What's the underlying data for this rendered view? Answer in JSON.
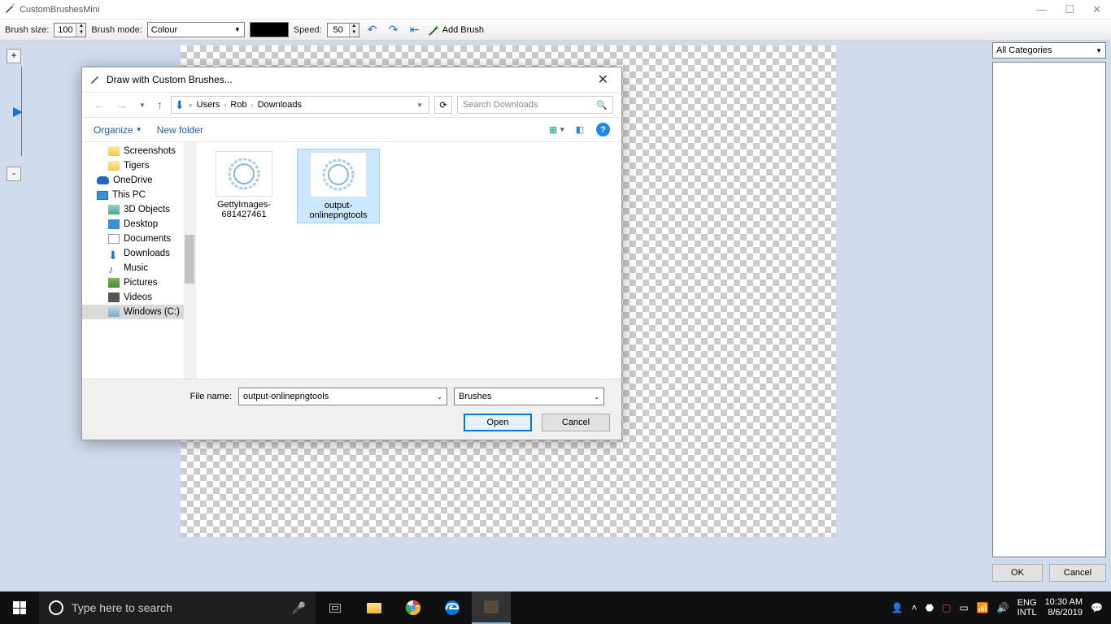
{
  "app": {
    "title": "CustomBrushesMini"
  },
  "toolbar": {
    "brush_size_label": "Brush size:",
    "brush_size_value": "100",
    "brush_mode_label": "Brush mode:",
    "brush_mode_value": "Colour",
    "speed_label": "Speed:",
    "speed_value": "50",
    "add_brush_label": "Add Brush"
  },
  "right_panel": {
    "category_value": "All Categories",
    "ok_label": "OK",
    "cancel_label": "Cancel"
  },
  "dialog": {
    "title": "Draw with Custom Brushes...",
    "breadcrumb": [
      "Users",
      "Rob",
      "Downloads"
    ],
    "search_placeholder": "Search Downloads",
    "organize_label": "Organize",
    "new_folder_label": "New folder",
    "tree": [
      {
        "label": "Screenshots",
        "type": "folder",
        "indent": true
      },
      {
        "label": "Tigers",
        "type": "folder",
        "indent": true
      },
      {
        "label": "OneDrive",
        "type": "cloud",
        "indent": false
      },
      {
        "label": "This PC",
        "type": "pc",
        "indent": false
      },
      {
        "label": "3D Objects",
        "type": "obj",
        "indent": true
      },
      {
        "label": "Desktop",
        "type": "desktop",
        "indent": true
      },
      {
        "label": "Documents",
        "type": "doc",
        "indent": true
      },
      {
        "label": "Downloads",
        "type": "dl",
        "indent": true
      },
      {
        "label": "Music",
        "type": "music",
        "indent": true
      },
      {
        "label": "Pictures",
        "type": "pic",
        "indent": true
      },
      {
        "label": "Videos",
        "type": "vid",
        "indent": true
      },
      {
        "label": "Windows (C:)",
        "type": "drive",
        "indent": true,
        "selected": true
      }
    ],
    "files": [
      {
        "name": "GettyImages-681427461",
        "selected": false
      },
      {
        "name": "output-onlinepngtools",
        "selected": true
      }
    ],
    "filename_label": "File name:",
    "filename_value": "output-onlinepngtools",
    "filetype_value": "Brushes",
    "open_label": "Open",
    "cancel_label": "Cancel"
  },
  "taskbar": {
    "search_placeholder": "Type here to search",
    "lang1": "ENG",
    "lang2": "INTL",
    "time": "10:30 AM",
    "date": "8/6/2019"
  }
}
